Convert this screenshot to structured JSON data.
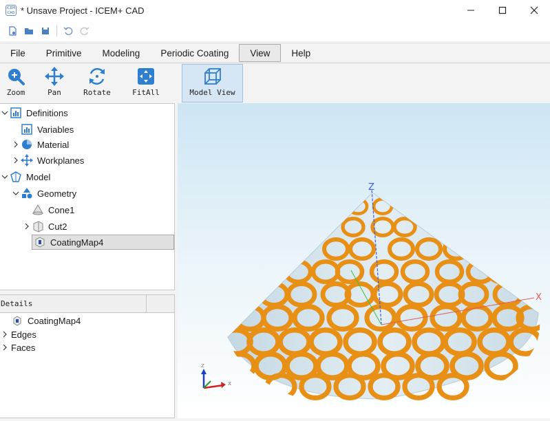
{
  "window": {
    "logo_text": "ICEM CAD",
    "title": "* Unsave Project - ICEM+ CAD"
  },
  "menu": {
    "items": [
      "File",
      "Primitive",
      "Modeling",
      "Periodic Coating",
      "View",
      "Help"
    ],
    "active": "View"
  },
  "ribbon": {
    "buttons": [
      {
        "label": "Zoom",
        "icon": "zoom-icon"
      },
      {
        "label": "Pan",
        "icon": "pan-icon"
      },
      {
        "label": "Rotate",
        "icon": "rotate-icon"
      },
      {
        "label": "FitAll",
        "icon": "fitall-icon"
      },
      {
        "label": "Model View",
        "icon": "model-view-icon",
        "selected": true
      }
    ]
  },
  "tree": {
    "definitions": "Definitions",
    "variables": "Variables",
    "material": "Material",
    "workplanes": "Workplanes",
    "model": "Model",
    "geometry": "Geometry",
    "cone": "Cone1",
    "cut": "Cut2",
    "coating": "CoatingMap4",
    "selected": "CoatingMap4"
  },
  "details": {
    "header": "Details",
    "item": "CoatingMap4",
    "edges": "Edges",
    "faces": "Faces"
  },
  "viewport": {
    "axis_z": "Z",
    "axis_x": "X",
    "triad_z": "z",
    "triad_x": "x",
    "ring_color": "#e88f15",
    "cone_color": "#c9dde8"
  }
}
